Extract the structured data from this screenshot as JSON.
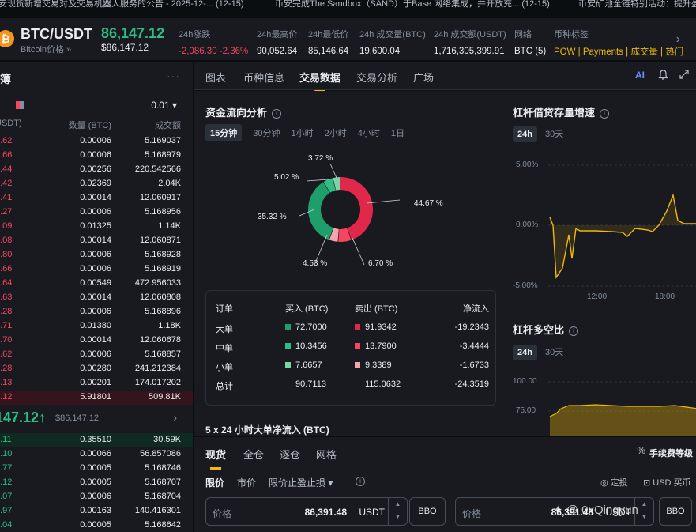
{
  "ticker": [
    {
      "text": "安现货新增交易对及交易机器人服务的公告 - 2025-12-... (12-15)"
    },
    {
      "text": "币安完成The Sandbox（SAND）于Base 网络集成，并开放充... (12-15)"
    },
    {
      "text": "币安矿池全链特别活动：提升盈"
    }
  ],
  "header": {
    "coin_icon": "bitcoin-icon",
    "pair": "BTC/USDT",
    "pair_sub": "Bitcoin价格 »",
    "last_price": "86,147.12",
    "last_price_usd": "$86,147.12",
    "stats": [
      {
        "label": "24h涨跌",
        "value": "-2,086.30 -2.36%",
        "color": "red"
      },
      {
        "label": "24h最高价",
        "value": "90,052.64"
      },
      {
        "label": "24h最低价",
        "value": "85,146.64"
      },
      {
        "label": "24h 成交量(BTC)",
        "value": "19,600.04"
      },
      {
        "label": "24h 成交额(USDT)",
        "value": "1,716,305,399.91"
      },
      {
        "label": "网络",
        "value": "BTC (5)"
      },
      {
        "label": "币种标签",
        "value": "POW | Payments | 成交量 | 热门"
      }
    ]
  },
  "orderbook": {
    "title": "簿",
    "more": "···",
    "step": "0.01 ▾",
    "headers": {
      "price": "USDT)",
      "qty": "数量 (BTC)",
      "total": "成交额"
    },
    "asks": [
      {
        "p": "0.62",
        "q": "0.00006",
        "t": "5.169037"
      },
      {
        "p": "9.66",
        "q": "0.00006",
        "t": "5.168979"
      },
      {
        "p": "9.44",
        "q": "0.00256",
        "t": "220.542566"
      },
      {
        "p": "9.42",
        "q": "0.02369",
        "t": "2.04K"
      },
      {
        "p": "9.41",
        "q": "0.00014",
        "t": "12.060917"
      },
      {
        "p": "9.27",
        "q": "0.00006",
        "t": "5.168956"
      },
      {
        "p": "9.09",
        "q": "0.01325",
        "t": "1.14K"
      },
      {
        "p": "9.08",
        "q": "0.00014",
        "t": "12.060871"
      },
      {
        "p": "8.80",
        "q": "0.00006",
        "t": "5.168928"
      },
      {
        "p": "8.66",
        "q": "0.00006",
        "t": "5.168919"
      },
      {
        "p": "8.64",
        "q": "0.00549",
        "t": "472.956033"
      },
      {
        "p": "8.63",
        "q": "0.00014",
        "t": "12.060808"
      },
      {
        "p": "8.28",
        "q": "0.00006",
        "t": "5.168896"
      },
      {
        "p": "7.71",
        "q": "0.01380",
        "t": "1.18K"
      },
      {
        "p": "7.70",
        "q": "0.00014",
        "t": "12.060678"
      },
      {
        "p": "7.62",
        "q": "0.00006",
        "t": "5.168857"
      },
      {
        "p": "7.28",
        "q": "0.00280",
        "t": "241.212384"
      },
      {
        "p": "7.13",
        "q": "0.00201",
        "t": "174.017202"
      },
      {
        "p": "7.12",
        "q": "5.91801",
        "t": "509.81K"
      }
    ],
    "mid_price": "147.12↑",
    "mid_usd": "$86,147.12",
    "mid_chev": "›",
    "bids": [
      {
        "p": "7.11",
        "q": "0.35510",
        "t": "30.59K"
      },
      {
        "p": "7.10",
        "q": "0.00066",
        "t": "56.857086"
      },
      {
        "p": "6.77",
        "q": "0.00005",
        "t": "5.168746"
      },
      {
        "p": "6.12",
        "q": "0.00005",
        "t": "5.168707"
      },
      {
        "p": "5.07",
        "q": "0.00006",
        "t": "5.168704"
      },
      {
        "p": "4.97",
        "q": "0.00163",
        "t": "140.416301"
      },
      {
        "p": "4.04",
        "q": "0.00005",
        "t": "5.168642"
      }
    ]
  },
  "tabs": [
    {
      "label": "图表"
    },
    {
      "label": "币种信息"
    },
    {
      "label": "交易数据",
      "active": true
    },
    {
      "label": "交易分析"
    },
    {
      "label": "广场"
    }
  ],
  "tab_icons": [
    "ai-icon",
    "bell-icon",
    "expand-icon"
  ],
  "flow": {
    "title": "资金流向分析",
    "intervals": [
      "15分钟",
      "30分钟",
      "1小时",
      "2小时",
      "4小时",
      "1日"
    ],
    "active_interval": "15分钟",
    "donut_labels": [
      "3.72 %",
      "5.02 %",
      "35.32 %",
      "4.53 %",
      "6.70 %",
      "44.67 %"
    ],
    "table": {
      "headers": [
        "订单",
        "买入 (BTC)",
        "卖出 (BTC)",
        "净流入"
      ],
      "rows": [
        {
          "name": "大单",
          "buy": "72.7000",
          "sell": "91.9342",
          "net": "-19.2343"
        },
        {
          "name": "中单",
          "buy": "10.3456",
          "sell": "13.7900",
          "net": "-3.4444"
        },
        {
          "name": "小单",
          "buy": "7.6657",
          "sell": "9.3389",
          "net": "-1.6733"
        },
        {
          "name": "总计",
          "buy": "90.7113",
          "sell": "115.0632",
          "net": "-24.3519"
        }
      ]
    },
    "cut_title": "5 x 24 小时大单净流入 (BTC)"
  },
  "margin": {
    "title": "杠杆借贷存量增速",
    "periods": [
      "24h",
      "30天"
    ],
    "active": "24h",
    "y_ticks": [
      "5.00%",
      "0.00%",
      "-5.00%"
    ],
    "x_ticks": [
      "12:00",
      "18:00"
    ]
  },
  "longshort": {
    "title": "杠杆多空比",
    "periods": [
      "24h",
      "30天"
    ],
    "active": "24h",
    "y_ticks": [
      "100.00",
      "75.00"
    ]
  },
  "colors": {
    "green": "#2ebd85",
    "red": "#f6465d",
    "yellow": "#f0b90b",
    "donut_buy_large": "#1e9e6a",
    "donut_buy_mid": "#2ebd85",
    "donut_buy_small": "#7ad4a4",
    "donut_sell_large": "#e0294a",
    "donut_sell_mid": "#f6465d",
    "donut_sell_small": "#f7a3ae"
  },
  "trade": {
    "tabs": [
      "现货",
      "全仓",
      "逐仓",
      "网格"
    ],
    "fee_icon": "%",
    "fee": "手续费等级",
    "order_types": [
      "限价",
      "市价",
      "限价止盈止损 ▾"
    ],
    "info_icon": "i",
    "right_links": [
      "定投",
      "USD 买币"
    ],
    "price_label": "价格",
    "price_value": "86,391.48",
    "price_unit": "USDT",
    "bbo": "BBO",
    "price_label_2": "价格",
    "price_value_2": "86,391.48",
    "price_unit_2": "USDT",
    "bbo_2": "BBO"
  },
  "watermark": "✦ @ 0xQingyun"
}
